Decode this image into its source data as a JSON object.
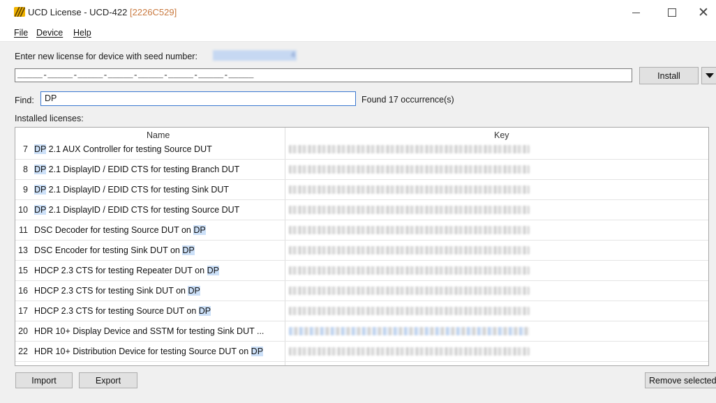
{
  "window": {
    "title": "UCD License - UCD-422",
    "title_suffix": "[2226C529]",
    "accent_color": "#f2b400"
  },
  "menu": {
    "items": [
      {
        "label": "File"
      },
      {
        "label": "Device"
      },
      {
        "label": "Help"
      }
    ]
  },
  "license_entry": {
    "prompt": "Enter new license for device with seed number:",
    "seed_value": "4",
    "input_value": "_____-_____-_____-_____-_____-_____-_____-_____",
    "install_label": "Install"
  },
  "find": {
    "label": "Find:",
    "value": "DP",
    "result": "Found 17 occurrence(s)"
  },
  "installed": {
    "label": "Installed licenses:",
    "columns": [
      "Name",
      "Key"
    ],
    "rows": [
      {
        "num": "7",
        "pre": "",
        "hl": "DP",
        "post": " 2.1 AUX Controller for testing Source DUT"
      },
      {
        "num": "8",
        "pre": "",
        "hl": "DP",
        "post": " 2.1 DisplayID / EDID CTS for testing Branch DUT"
      },
      {
        "num": "9",
        "pre": "",
        "hl": "DP",
        "post": " 2.1 DisplayID / EDID CTS for testing Sink DUT"
      },
      {
        "num": "10",
        "pre": "",
        "hl": "DP",
        "post": " 2.1 DisplayID / EDID CTS for testing Source DUT"
      },
      {
        "num": "11",
        "pre": "DSC Decoder for testing Source DUT on ",
        "hl": "DP",
        "post": ""
      },
      {
        "num": "13",
        "pre": "DSC Encoder for testing Sink DUT on ",
        "hl": "DP",
        "post": ""
      },
      {
        "num": "15",
        "pre": "HDCP 2.3 CTS for testing Repeater DUT on ",
        "hl": "DP",
        "post": ""
      },
      {
        "num": "16",
        "pre": "HDCP 2.3 CTS for testing Sink DUT on ",
        "hl": "DP",
        "post": ""
      },
      {
        "num": "17",
        "pre": "HDCP 2.3 CTS for testing Source DUT on ",
        "hl": "DP",
        "post": ""
      },
      {
        "num": "20",
        "pre": "HDR 10+ Display Device and SSTM for testing Sink DUT ...",
        "hl": "",
        "post": ""
      },
      {
        "num": "22",
        "pre": "HDR 10+ Distribution Device for testing Source DUT on ",
        "hl": "DP",
        "post": ""
      }
    ]
  },
  "actions": {
    "import_label": "Import",
    "export_label": "Export",
    "remove_label": "Remove selected"
  },
  "colors": {
    "highlight": "#cce0f8",
    "focus_border": "#3a78d0"
  }
}
